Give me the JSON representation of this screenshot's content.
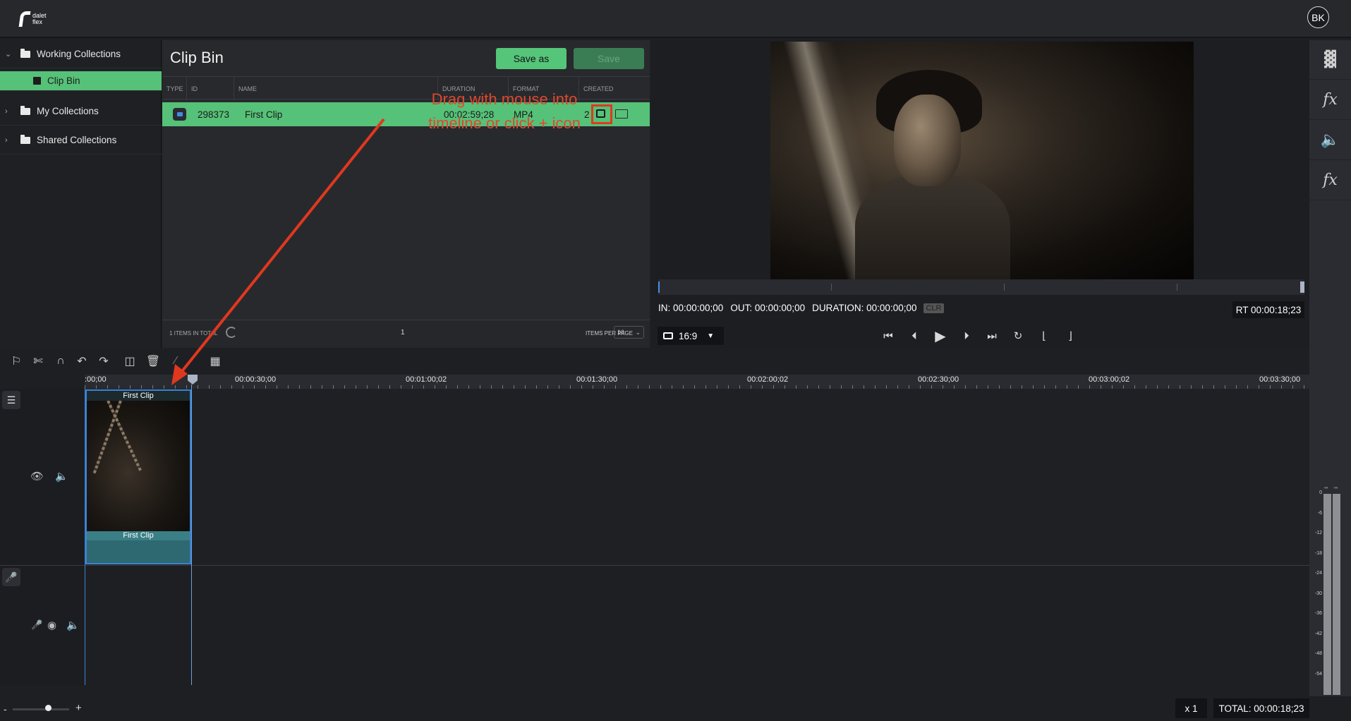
{
  "app": {
    "logo_text": "dalet flex",
    "user_initials": "BK"
  },
  "sidebar": {
    "items": [
      {
        "label": "Working Collections",
        "expanded": true
      },
      {
        "label": "Clip Bin",
        "selected": true
      },
      {
        "label": "My Collections",
        "expanded": false
      },
      {
        "label": "Shared Collections",
        "expanded": false
      }
    ]
  },
  "clip_bin": {
    "title": "Clip Bin",
    "save_as_label": "Save as",
    "save_label": "Save",
    "columns": [
      "TYPE",
      "ID",
      "NAME",
      "DURATION",
      "FORMAT",
      "CREATED"
    ],
    "rows": [
      {
        "type_icon": "video-icon",
        "id": "298373",
        "name": "First Clip",
        "duration": "00:02:59;28",
        "format": "MP4",
        "created": "2"
      }
    ],
    "items_total": "1 ITEMS IN TOTAL",
    "page": "1",
    "items_per_page_label": "ITEMS PER PAGE",
    "items_per_page": "10"
  },
  "annotation": {
    "line1": "Drag with mouse into",
    "line2": "timeline or click + icon",
    "color": "#e0482e"
  },
  "viewer": {
    "in": "IN: 00:00:00;00",
    "out": "OUT: 00:00:00;00",
    "duration": "DURATION: 00:00:00;00",
    "clr": "CLR",
    "rt": "RT 00:00:18;23",
    "aspect": "16:9"
  },
  "right_panel": {
    "icons": [
      "bins-icon",
      "video-fx-icon",
      "audio-icon",
      "audio-fx-icon"
    ],
    "meter_scale": [
      "0",
      "-6",
      "-12",
      "-18",
      "-24",
      "-30",
      "-36",
      "-42",
      "-48",
      "-54"
    ],
    "meter_top": [
      "-∞",
      "-∞"
    ]
  },
  "timeline": {
    "ruler_labels": [
      ":00;00",
      "00:00:30;00",
      "00:01:00;02",
      "00:01:30;00",
      "00:02:00;02",
      "00:02:30;00",
      "00:03:00;02",
      "00:03:30;00"
    ],
    "clip_name": "First Clip",
    "clip_audio_name": "First Clip",
    "speed": "x 1",
    "total": "TOTAL: 00:00:18;23"
  },
  "colors": {
    "accent_green": "#56c178",
    "annotation_red": "#e0381f",
    "clip_blue": "#3b82d6"
  }
}
